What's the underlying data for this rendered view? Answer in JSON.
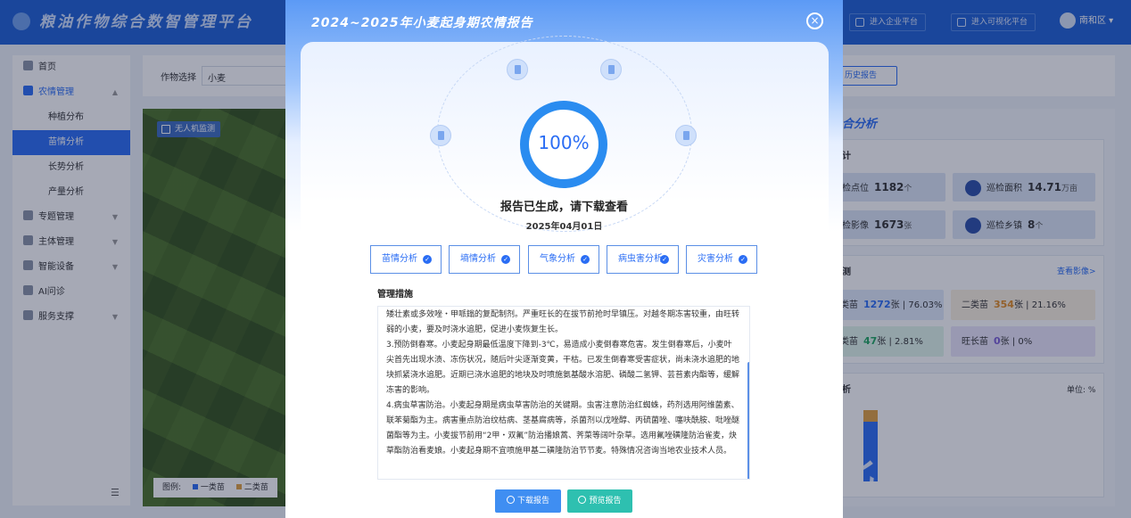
{
  "app": {
    "title": "粮油作物综合数智管理平台",
    "enterprise_btn": "进入企业平台",
    "visual_btn": "进入可视化平台",
    "user": "南和区"
  },
  "sidebar": {
    "items": [
      {
        "label": "首页"
      },
      {
        "label": "农情管理"
      },
      {
        "label": "种植分布"
      },
      {
        "label": "苗情分析"
      },
      {
        "label": "长势分析"
      },
      {
        "label": "产量分析"
      },
      {
        "label": "专题管理"
      },
      {
        "label": "主体管理"
      },
      {
        "label": "智能设备"
      },
      {
        "label": "AI问诊"
      },
      {
        "label": "服务支撑"
      }
    ]
  },
  "main": {
    "crop_label": "作物选择",
    "crop_value": "小麦",
    "history_btn": "历史报告",
    "drone_tag": "无人机监测",
    "legend": {
      "label": "图例:",
      "items": [
        "一类苗",
        "二类苗"
      ],
      "colors": [
        "#2a6df4",
        "#e0a040"
      ]
    }
  },
  "right_panel": {
    "title": "合分析",
    "stats_title": "计",
    "stats": [
      {
        "label": "检点位",
        "value": "1182",
        "unit": "个"
      },
      {
        "label": "巡检面积",
        "value": "14.71",
        "unit": "万亩"
      },
      {
        "label": "检影像",
        "value": "1673",
        "unit": "张"
      },
      {
        "label": "巡检乡镇",
        "value": "8",
        "unit": "个"
      }
    ],
    "monitor_title": "测",
    "view_images": "查看影像>",
    "grades": [
      {
        "label": "类苗",
        "value": "1272",
        "unit": "张",
        "pct": "76.03%"
      },
      {
        "label": "二类苗",
        "value": "354",
        "unit": "张",
        "pct": "21.16%"
      },
      {
        "label": "类苗",
        "value": "47",
        "unit": "张",
        "pct": "2.81%"
      },
      {
        "label": "旺长苗",
        "value": "0",
        "unit": "张",
        "pct": "0%"
      }
    ],
    "analysis_title": "析",
    "unit_label": "单位: %",
    "watermark": "北广播电视台"
  },
  "modal": {
    "title": "2024~2025年小麦起身期农情报告",
    "progress": "100%",
    "status": "报告已生成，请下载查看",
    "date": "2025年04月01日",
    "tabs": [
      "苗情分析",
      "墒情分析",
      "气象分析",
      "病虫害分析",
      "灾害分析"
    ],
    "measures_title": "管理措施",
    "measures_paragraphs": [
      "矮壮素或多效唑・甲哌鎓的复配制剂。严重旺长的在拔节前抢时早镇压。对越冬期冻害较重，由旺转弱的小麦，要及时浇水追肥，促进小麦恢复生长。",
      "3.预防倒春寒。小麦起身期最低温度下降到-3℃，易造成小麦倒春寒危害。发生倒春寒后，小麦叶尖首先出现水渍、冻伤状况，随后叶尖逐渐变黄，干枯。已发生倒春寒受害症状，尚未浇水追肥的地块抓紧浇水追肥。近期已浇水追肥的地块及时喷施氨基酸水溶肥、磷酸二氢钾、芸苔素内酯等，缓解冻害的影响。",
      "4.病虫草害防治。小麦起身期是病虫草害防治的关键期。虫害注意防治红蜘蛛，药剂选用阿维菌素、联苯菊酯为主。病害重点防治纹枯病、茎基腐病等，杀菌剂以戊唑醇、丙硫菌唑、噻呋酰胺、吡唑醚菌酯等为主。小麦拔节前用“2甲・双氟”防治播娘蒿、荠菜等阔叶杂草。选用氟唑磺隆防治雀麦，炔草酯防治看麦娘。小麦起身期不宜喷施甲基二磺隆防治节节麦。特殊情况咨询当地农业技术人员。"
    ],
    "download_btn": "下载报告",
    "preview_btn": "预览报告"
  }
}
